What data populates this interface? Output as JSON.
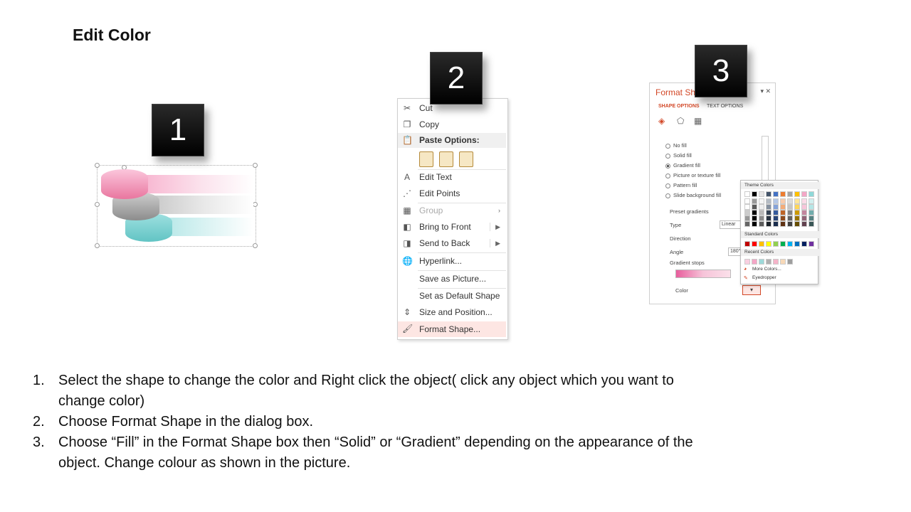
{
  "title": "Edit Color",
  "steps": [
    "1",
    "2",
    "3"
  ],
  "context_menu": {
    "items": [
      {
        "label": "Cut",
        "icon": "scissors-icon"
      },
      {
        "label": "Copy",
        "icon": "copy-icon"
      },
      {
        "label": "Paste Options:",
        "icon": "paste-icon"
      },
      {
        "label": "Edit Text",
        "icon": "edit-text-icon"
      },
      {
        "label": "Edit Points",
        "icon": "edit-points-icon"
      },
      {
        "label": "Group",
        "icon": "group-icon"
      },
      {
        "label": "Bring to Front",
        "icon": "bring-front-icon"
      },
      {
        "label": "Send to Back",
        "icon": "send-back-icon"
      },
      {
        "label": "Hyperlink...",
        "icon": "hyperlink-icon"
      },
      {
        "label": "Save as Picture...",
        "icon": ""
      },
      {
        "label": "Set as Default Shape",
        "icon": ""
      },
      {
        "label": "Size and Position...",
        "icon": "size-position-icon"
      },
      {
        "label": "Format Shape...",
        "icon": "format-shape-icon"
      }
    ]
  },
  "format_pane": {
    "title": "Format Sh",
    "tabs": [
      "SHAPE OPTIONS",
      "TEXT OPTIONS"
    ],
    "fill_options": [
      "No fill",
      "Solid fill",
      "Gradient fill",
      "Picture or texture fill",
      "Pattern fill",
      "Slide background fill"
    ],
    "selected_fill": "Gradient fill",
    "labels": {
      "preset": "Preset gradients",
      "type": "Type",
      "type_value": "Linear",
      "direction": "Direction",
      "angle": "Angle",
      "angle_value": "180°",
      "stops": "Gradient stops",
      "color": "Color"
    }
  },
  "palette": {
    "theme_header": "Theme Colors",
    "standard_header": "Standard Colors",
    "recent_header": "Recent Colors",
    "more_colors": "More Colors...",
    "eyedropper": "Eyedropper",
    "theme_top": [
      "#ffffff",
      "#000000",
      "#e7e6e6",
      "#44546a",
      "#4472c4",
      "#ed7d31",
      "#a5a5a5",
      "#ffc000",
      "#f4a6c6",
      "#8fd8d8"
    ],
    "standard": [
      "#c00000",
      "#ff0000",
      "#ffc000",
      "#ffff00",
      "#92d050",
      "#00b050",
      "#00b0f0",
      "#0070c0",
      "#002060",
      "#7030a0"
    ],
    "recent": [
      "#f9cfe0",
      "#f4a6c6",
      "#9dd9d9",
      "#b0b0b0",
      "#f5b3c8",
      "#f8d9b8",
      "#9e9e9e"
    ]
  },
  "instructions": [
    {
      "num": "1.",
      "text": "Select the shape to change the color and Right click the object( click any object which you want to change color)"
    },
    {
      "num": "2.",
      "text": "Choose Format Shape in the dialog box."
    },
    {
      "num": "3.",
      "text": "Choose “Fill” in the Format Shape box then “Solid” or “Gradient” depending on the appearance of the object. Change colour as shown in the picture."
    }
  ]
}
